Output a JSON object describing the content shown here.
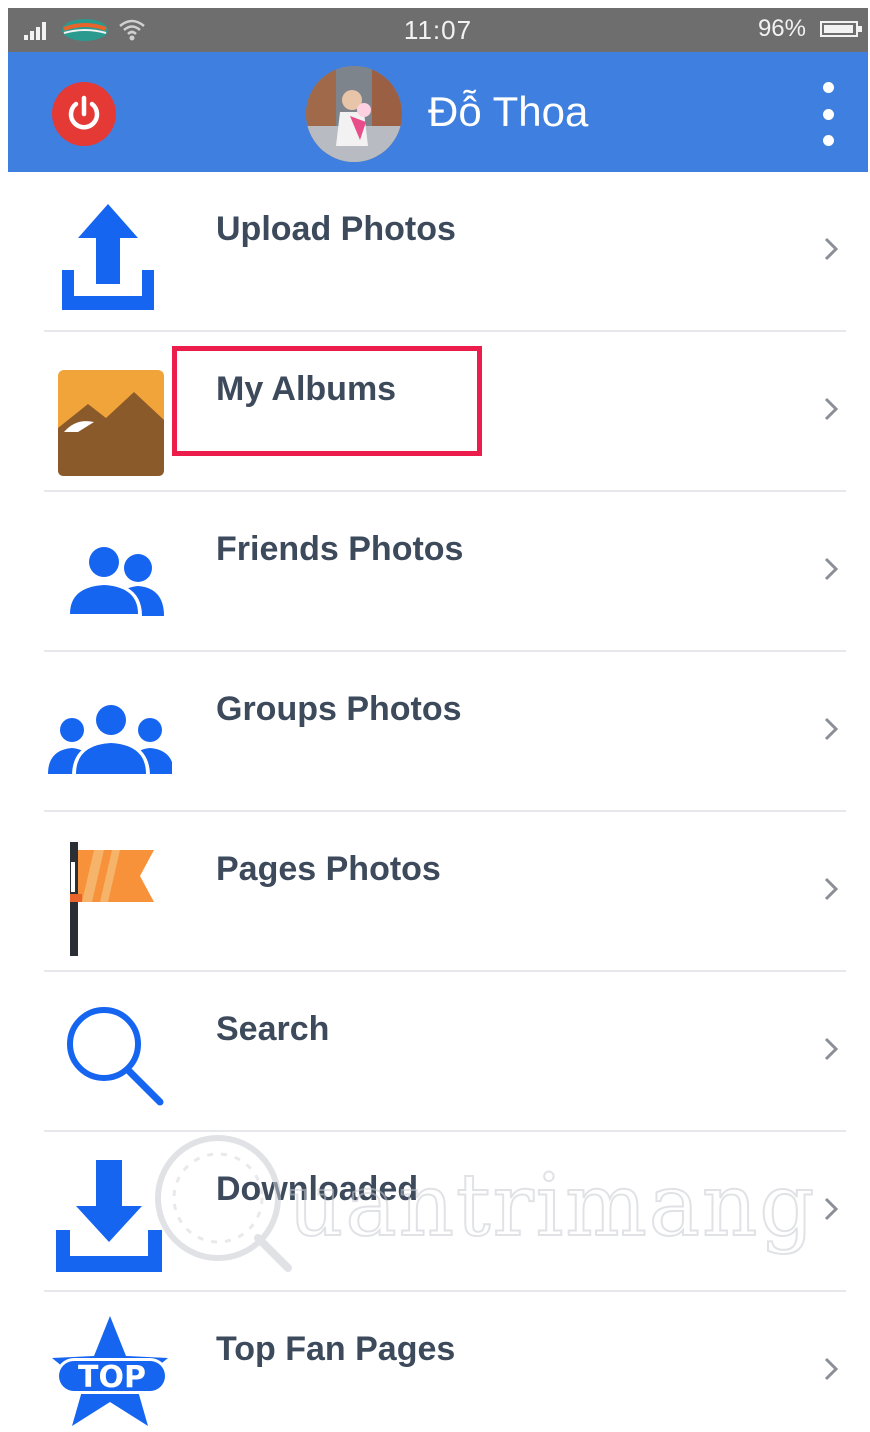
{
  "status_bar": {
    "time": "11:07",
    "battery": "96%",
    "battery_level": 0.96
  },
  "header": {
    "user_name": "Đỗ Thoa"
  },
  "menu": {
    "items": [
      {
        "label": "Upload Photos",
        "icon": "upload-icon"
      },
      {
        "label": "My Albums",
        "icon": "album-icon",
        "highlighted": true
      },
      {
        "label": "Friends Photos",
        "icon": "friends-icon"
      },
      {
        "label": "Groups Photos",
        "icon": "groups-icon"
      },
      {
        "label": "Pages Photos",
        "icon": "flag-icon"
      },
      {
        "label": "Search",
        "icon": "search-icon"
      },
      {
        "label": "Downloaded",
        "icon": "download-icon"
      },
      {
        "label": "Top Fan Pages",
        "icon": "top-star-icon"
      }
    ]
  },
  "watermark": {
    "text": "uantrimang"
  },
  "colors": {
    "header_blue": "#3f7fe0",
    "icon_blue": "#1565f0",
    "power_red": "#e53935",
    "highlight_red": "#ec1c4b",
    "label_text": "#3c4a5c"
  }
}
